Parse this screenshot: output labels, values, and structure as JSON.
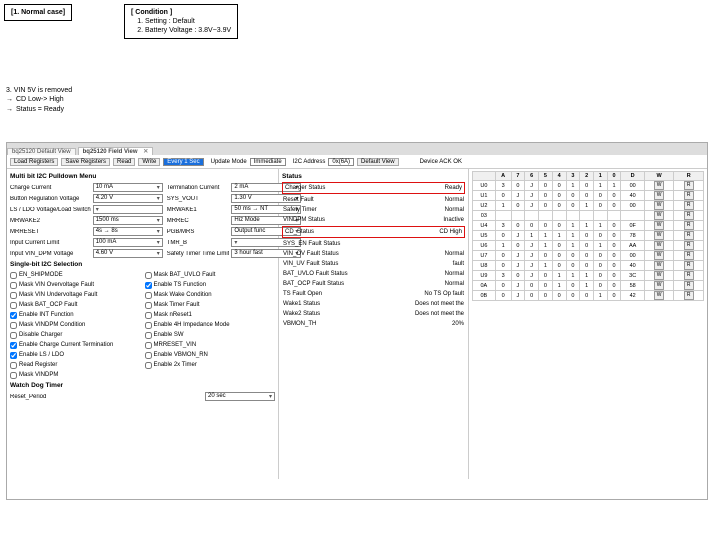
{
  "case": "[1. Normal case]",
  "condition": {
    "header": "[ Condition ]",
    "lines": [
      "Setting : Default",
      "Battery Voltage : 3.8V~3.9V"
    ]
  },
  "step3": {
    "l1": "3. VIN 5V is removed",
    "l2": "CD Low-> High",
    "l3": "Status = Ready"
  },
  "tabs": {
    "t0": "bq25120 Default View",
    "t1": "bq25120 Field View",
    "t1x": "✕"
  },
  "toolbar": {
    "b0": "Load Registers",
    "b1": "Save Registers",
    "b2": "Read",
    "b3": "Write",
    "every": "Every 1 Sec",
    "updLab": "Update Mode",
    "upd": "Immediate",
    "i2cLab": "I2C Address",
    "i2c": "0x(6A)",
    "b4": "Default View",
    "devLab": "Device ACK OK"
  },
  "multiSect": "Multi bit I2C Pulldown Menu",
  "left": {
    "r0": {
      "l": "Charge Current",
      "v": "10 mA"
    },
    "r1": {
      "l": "Button Regulation Voltage",
      "v": "4.20 V"
    },
    "r2": {
      "l": "LS / LDO Voltage/Load Switch",
      "v": ""
    },
    "r3": {
      "l": "MRWAKE2",
      "v": "1500 ms"
    },
    "r4": {
      "l": "MRRESET",
      "v": "4s → 8s"
    },
    "r5": {
      "l": "Input Current Limit",
      "v": "100 mA"
    },
    "r6": {
      "l": "Input VIN_DPM Voltage",
      "v": "4.60 V"
    },
    "c1": {
      "l": "Termination Current",
      "v": "2 mA"
    },
    "c2": {
      "l": "SYS_VOUT",
      "v": "1.30 V"
    },
    "c3": {
      "l": "MRWAKE1",
      "v": "50 ms → NT"
    },
    "c4": {
      "l": "MRREC",
      "v": "Hiz Mode"
    },
    "c5": {
      "l": "PGB/MRS",
      "v": "Output func"
    },
    "c6": {
      "l": "TMR_B",
      "v": ""
    },
    "c7": {
      "l": "Safety Timer Time Limit",
      "v": "3 hour fast"
    }
  },
  "singleSect": "Single-bit I2C Selection",
  "cbL": [
    {
      "t": "EN_SHIPMODE",
      "c": false
    },
    {
      "t": "Mask VIN Overvoltage Fault",
      "c": false
    },
    {
      "t": "Mask VIN Undervoltage Fault",
      "c": false
    },
    {
      "t": "Mask BAT_OCP Fault",
      "c": false
    },
    {
      "t": "Enable INT Function",
      "c": true
    },
    {
      "t": "Mask VINDPM Condition",
      "c": false
    },
    {
      "t": "Disable Charger",
      "c": false
    },
    {
      "t": "Enable Charge Current Termination",
      "c": true
    },
    {
      "t": "Enable LS / LDO",
      "c": true
    },
    {
      "t": "Read Register",
      "c": false
    },
    {
      "t": "Mask VINDPM",
      "c": false
    }
  ],
  "cbR": [
    {
      "t": "Mask BAT_UVLO Fault",
      "c": false
    },
    {
      "t": "Enable TS Function",
      "c": true
    },
    {
      "t": "Mask Wake Condition",
      "c": false
    },
    {
      "t": "Mask Timer Fault",
      "c": false
    },
    {
      "t": "Mask nReset1",
      "c": false
    },
    {
      "t": "Enable 4H Impedance Mode",
      "c": false
    },
    {
      "t": "Enable SW",
      "c": false
    },
    {
      "t": "MRRESET_VIN",
      "c": false
    },
    {
      "t": "Enable VBMON_RN",
      "c": false
    },
    {
      "t": "Enable 2x Timer",
      "c": false
    }
  ],
  "wdSect": "Watch Dog Timer",
  "wd": {
    "l": "Reset_Period",
    "v": "20 sec"
  },
  "statusSect": "Status",
  "status": [
    {
      "l": "Charger Status",
      "v": "Ready",
      "hl": true
    },
    {
      "l": "Reset Fault",
      "v": "Normal"
    },
    {
      "l": "Safety Timer",
      "v": "Normal"
    },
    {
      "l": "VINDPM Status",
      "v": "Inactive"
    },
    {
      "l": "CD_Status",
      "v": "CD High",
      "hl": true
    },
    {
      "l": "SYS_EN Fault Status",
      "v": ""
    },
    {
      "l": "VIN_OV Fault Status",
      "v": "Normal"
    },
    {
      "l": "VIN_UV Fault Status",
      "v": "fault"
    },
    {
      "l": "BAT_UVLO Fault Status",
      "v": "Normal"
    },
    {
      "l": "BAT_OCP Fault Status",
      "v": "Normal"
    },
    {
      "l": "TS Fault Open",
      "v": "No TS Op fault"
    },
    {
      "l": "Wake1 Status",
      "v": "Does not meet the"
    },
    {
      "l": "Wake2 Status",
      "v": "Does not meet the"
    },
    {
      "l": "VBMON_TH",
      "v": "20%"
    }
  ],
  "gridH": [
    "",
    "A",
    "7",
    "6",
    "5",
    "4",
    "3",
    "2",
    "1",
    "0",
    "D",
    "W",
    "R"
  ],
  "gridR": [
    [
      "U0",
      "3",
      "0",
      "J",
      "0",
      "0",
      "1",
      "0",
      "1",
      "1",
      "00",
      "W",
      "R"
    ],
    [
      "U1",
      "0",
      "J",
      "J",
      "0",
      "0",
      "0",
      "0",
      "0",
      "0",
      "40",
      "W",
      "R"
    ],
    [
      "U2",
      "1",
      "0",
      "J",
      "0",
      "0",
      "0",
      "1",
      "0",
      "0",
      "00",
      "W",
      "R"
    ],
    [
      "03",
      "",
      "",
      "",
      "",
      "",
      "",
      "",
      "",
      "",
      "",
      "W",
      "R"
    ],
    [
      "U4",
      "3",
      "0",
      "0",
      "0",
      "0",
      "1",
      "1",
      "1",
      "0",
      "0F",
      "W",
      "R"
    ],
    [
      "U5",
      "0",
      "J",
      "1",
      "1",
      "1",
      "1",
      "0",
      "0",
      "0",
      "78",
      "W",
      "R"
    ],
    [
      "U6",
      "1",
      "0",
      "J",
      "1",
      "0",
      "1",
      "0",
      "1",
      "0",
      "AA",
      "W",
      "R"
    ],
    [
      "U7",
      "0",
      "J",
      "J",
      "0",
      "0",
      "0",
      "0",
      "0",
      "0",
      "00",
      "W",
      "R"
    ],
    [
      "U8",
      "0",
      "J",
      "J",
      "1",
      "0",
      "0",
      "0",
      "0",
      "0",
      "40",
      "W",
      "R"
    ],
    [
      "U9",
      "3",
      "0",
      "J",
      "0",
      "1",
      "1",
      "1",
      "0",
      "0",
      "3C",
      "W",
      "R"
    ],
    [
      "0A",
      "0",
      "J",
      "0",
      "0",
      "1",
      "0",
      "1",
      "0",
      "0",
      "58",
      "W",
      "R"
    ],
    [
      "0B",
      "0",
      "J",
      "0",
      "0",
      "0",
      "0",
      "0",
      "1",
      "0",
      "42",
      "W",
      "R"
    ]
  ]
}
